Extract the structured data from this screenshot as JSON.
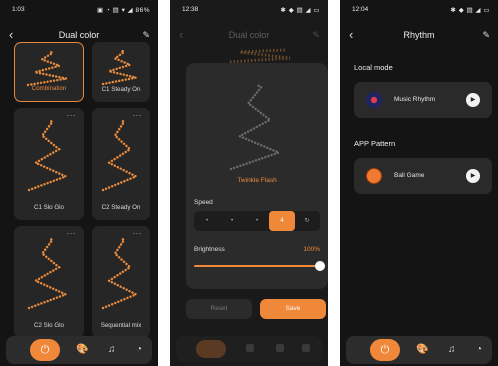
{
  "panel1": {
    "status": {
      "time": "1:03",
      "icons": "▣ ◔ ▤ ▾ ◢ 86%"
    },
    "title": "Dual color",
    "cards": [
      {
        "label": "Combination",
        "selected": true,
        "has_menu": false
      },
      {
        "label": "C1 Steady On",
        "selected": false,
        "has_menu": false
      },
      {
        "label": "C1 Slo Glo",
        "selected": false,
        "has_menu": true
      },
      {
        "label": "C2 Steady On",
        "selected": false,
        "has_menu": true
      },
      {
        "label": "C2 Slo Glo",
        "selected": false,
        "has_menu": true
      },
      {
        "label": "Sequential mix",
        "selected": false,
        "has_menu": true
      }
    ],
    "menu_dots": "···"
  },
  "panel2": {
    "status": {
      "time": "12:38",
      "icons": "✱ ◆ ▤ ◢ ▭"
    },
    "title": "Dual color",
    "mode_name": "Twinkle Flash",
    "speed_label": "Speed",
    "speed_options": [
      "•",
      "•",
      "•",
      "4",
      "↻"
    ],
    "speed_selected_index": 3,
    "brightness_label": "Brightness",
    "brightness_value": "100%",
    "brightness_fraction": 1.0,
    "reset_label": "Reset",
    "save_label": "Save"
  },
  "panel3": {
    "status": {
      "time": "12:04",
      "icons": "✱ ◆ ▤ ◢ ▭"
    },
    "title": "Rhythm",
    "local_mode_label": "Local mode",
    "music_rhythm_label": "Music Rhythm",
    "app_pattern_label": "APP Pattern",
    "ball_game_label": "Ball Game"
  },
  "colors": {
    "accent": "#f0883a",
    "background": "#141414",
    "card": "#262626"
  },
  "icons": {
    "power": "power-icon",
    "palette": "palette-icon",
    "music": "music-note-icon",
    "clock": "clock-icon",
    "play": "play-icon"
  }
}
